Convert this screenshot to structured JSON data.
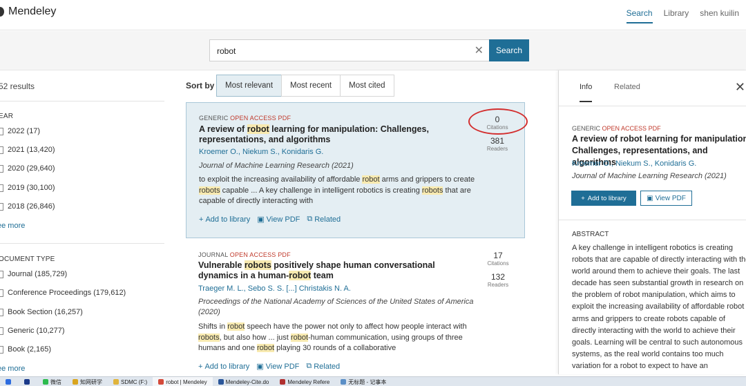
{
  "header": {
    "app_name": "Mendeley",
    "nav": [
      "Search",
      "Library",
      "shen kuilin"
    ]
  },
  "search": {
    "query": "robot",
    "clear_icon": "close-icon",
    "button_label": "Search"
  },
  "filters": {
    "results_count": "52 results",
    "year": {
      "title": "EAR",
      "options": [
        "2022 (17)",
        "2021 (13,420)",
        "2020 (29,640)",
        "2019 (30,100)",
        "2018 (26,846)"
      ],
      "see_more": "ee more"
    },
    "doc_type": {
      "title": "OCUMENT TYPE",
      "options": [
        "Journal (185,729)",
        "Conference Proceedings (179,612)",
        "Book Section (16,257)",
        "Generic (10,277)",
        "Book (2,165)"
      ],
      "see_more": "ee more"
    }
  },
  "sort": {
    "label": "Sort by",
    "options": [
      "Most relevant",
      "Most recent",
      "Most cited"
    ],
    "active": "Most relevant"
  },
  "results": [
    {
      "type": "GENERIC",
      "open_access": "OPEN ACCESS",
      "pdf_tag": "PDF",
      "title_parts": [
        "A review of ",
        "robot",
        " learning for manipulation: Challenges, representations, and algorithms"
      ],
      "authors": "Kroemer O., Niekum S., Konidaris G.",
      "journal": "Journal of Machine Learning Research (2021)",
      "snippet_parts": [
        "to exploit the increasing availability of affordable ",
        "robot",
        " arms and grippers to create ",
        "robots",
        " capable ... A key challenge in intelligent robotics is creating ",
        "robots",
        " that are capable of directly interacting with"
      ],
      "citations": "0",
      "citations_label": "Citations",
      "readers": "381",
      "readers_label": "Readers",
      "actions": [
        "Add to library",
        "View PDF",
        "Related"
      ]
    },
    {
      "type": "JOURNAL",
      "open_access": "OPEN ACCESS",
      "pdf_tag": "PDF",
      "title_parts": [
        "Vulnerable ",
        "robots",
        " positively shape human conversational dynamics in a human-",
        "robot",
        " team"
      ],
      "authors": "Traeger M. L., Sebo S. S. [...] Christakis N. A.",
      "journal": "Proceedings of the National Academy of Sciences of the United States of America (2020)",
      "snippet_parts": [
        "Shifts in ",
        "robot",
        " speech have the power not only to affect how people interact with ",
        "robots",
        ", but also how ... just ",
        "robot",
        "-human communication, using groups of three humans and one ",
        "robot",
        " playing 30 rounds of a collaborative"
      ],
      "citations": "17",
      "citations_label": "Citations",
      "readers": "132",
      "readers_label": "Readers",
      "actions": [
        "Add to library",
        "View PDF",
        "Related"
      ]
    }
  ],
  "panel": {
    "tabs": [
      "Info",
      "Related"
    ],
    "type": "GENERIC",
    "open_access": "OPEN ACCESS",
    "pdf_tag": "PDF",
    "title": "A review of robot learning for manipulation: Challenges, representations, and algorithms",
    "authors": "Kroemer O., Niekum S., Konidaris G.",
    "journal": "Journal of Machine Learning Research (2021)",
    "add_label": "Add to library",
    "pdf_label": "View PDF",
    "abstract_title": "ABSTRACT",
    "abstract": "A key challenge in intelligent robotics is creating robots that are capable of directly interacting with the world around them to achieve their goals. The last decade has seen substantial growth in research on the problem of robot manipulation, which aims to exploit the increasing availability of affordable robot arms and grippers to create robots capable of directly interacting with the world to achieve their goals. Learning will be central to such autonomous systems, as the real world contains too much variation for a robot to expect to have an"
  },
  "taskbar": [
    {
      "label": "",
      "color": "#2d6cdf"
    },
    {
      "label": "",
      "color": "#1b3a8a"
    },
    {
      "label": "微信",
      "color": "#2dbb4e"
    },
    {
      "label": "知网研学",
      "color": "#d9a520"
    },
    {
      "label": "SDMC (F:)",
      "color": "#e0b43c"
    },
    {
      "label": "robot | Mendeley",
      "color": "#d44a3a",
      "active": true
    },
    {
      "label": "Mendeley-Cite.do",
      "color": "#2b579a"
    },
    {
      "label": "Mendeley Refere",
      "color": "#b03030"
    },
    {
      "label": "无标题 - 记事本",
      "color": "#5b8fc7"
    }
  ],
  "accent_color": "#1f6e96",
  "highlight_color": "#f8eab0",
  "annotation_color": "#d32f2f"
}
